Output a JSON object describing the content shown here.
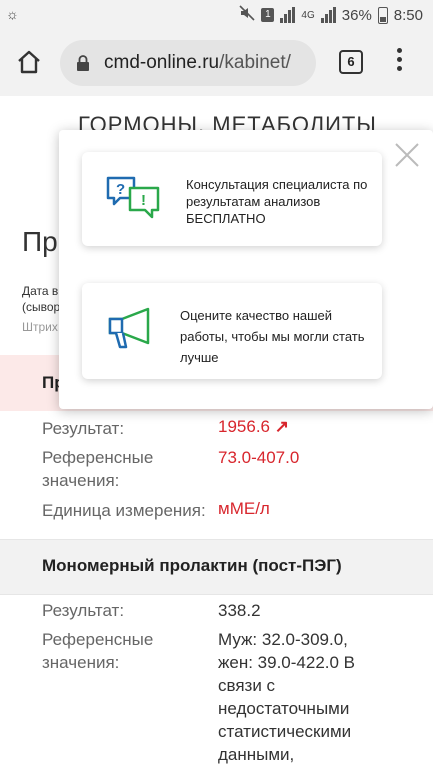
{
  "status_bar": {
    "sim_badge": "1",
    "network": "4G",
    "battery": "36%",
    "time": "8:50"
  },
  "browser": {
    "url_domain": "cmd-online.ru",
    "url_path": "/kabinet/",
    "tab_count": "6"
  },
  "page": {
    "section_heading": "ГОРМОНЫ, МЕТАБОЛИТЫ",
    "title_partial": "Пр",
    "date_label_partial": "Дата в",
    "date_sub_partial": "(сывор",
    "barcode_partial": "Штрих",
    "test1_partial": "Пр",
    "test1": {
      "result_label": "Результат:",
      "result_value": "1956.6",
      "result_flag": "↗",
      "reference_label": "Референсные значения:",
      "reference_value": "73.0-407.0",
      "unit_label": "Единица измерения:",
      "unit_value": "мМЕ/л"
    },
    "test2": {
      "name": "Мономерный пролактин (пост-ПЭГ)",
      "result_label": "Результат:",
      "result_value": "338.2",
      "reference_label": "Референсные значения:",
      "reference_value": "Муж: 32.0-309.0, жен: 39.0-422.0 В связи с недостаточными статистическими данными,"
    }
  },
  "popup": {
    "card1_text": "Консультация специалиста по результатам анализов БЕСПЛАТНО",
    "card1_icon": "question-exclamation-bubbles-icon",
    "card2_text": "Оцените качество нашей работы, чтобы мы могли стать лучше",
    "card2_icon": "megaphone-icon"
  },
  "colors": {
    "accent_red": "#d8262d",
    "icon_blue": "#1f6bb0",
    "icon_green": "#2aa84a"
  }
}
